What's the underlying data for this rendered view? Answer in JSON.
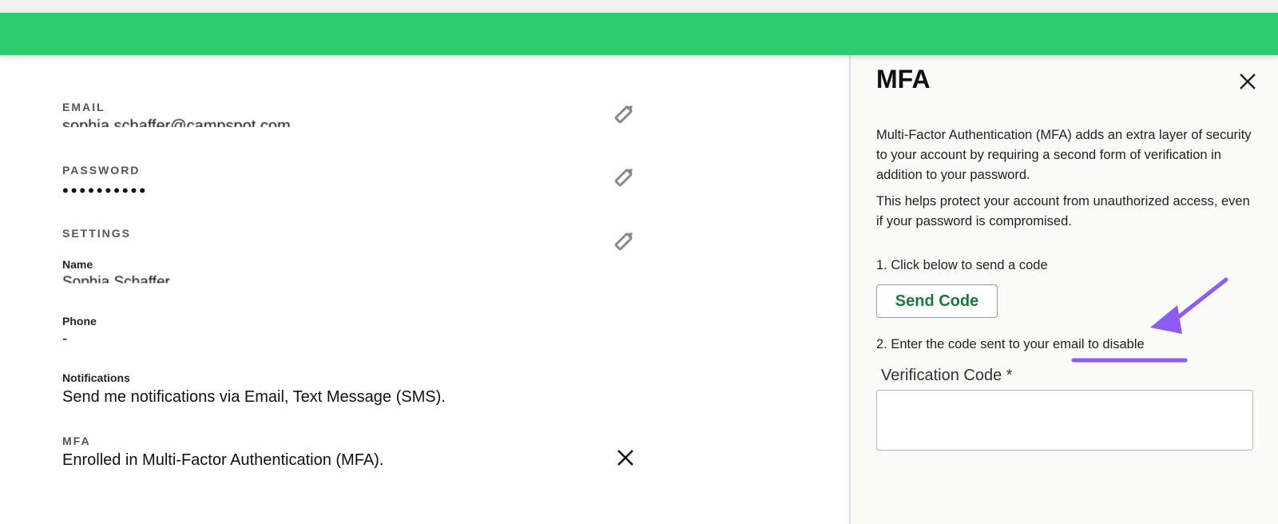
{
  "account": {
    "email_label": "EMAIL",
    "email_value": "sophia.schaffer@campspot.com",
    "password_label": "PASSWORD",
    "password_value": "••••••••••",
    "settings_label": "SETTINGS",
    "name_label": "Name",
    "name_value": "Sophia Schaffer",
    "phone_label": "Phone",
    "phone_value": "-",
    "notifications_label": "Notifications",
    "notifications_value": "Send me notifications via Email, Text Message (SMS).",
    "mfa_label": "MFA",
    "mfa_value": "Enrolled in Multi-Factor Authentication (MFA)."
  },
  "panel": {
    "title": "MFA",
    "desc1": "Multi-Factor Authentication (MFA) adds an extra layer of security to your account by requiring a second form of verification in addition to your password.",
    "desc2": "This helps protect your account from unauthorized access, even if your password is compromised.",
    "step1": "1. Click below to send a code",
    "send_button": "Send Code",
    "step2": "2. Enter the code sent to your email to disable",
    "verification_label": "Verification Code *",
    "verification_value": ""
  },
  "colors": {
    "header_green": "#2ecc71",
    "send_button_text": "#1a7a3c",
    "annotation_purple": "#8b5cf6"
  },
  "icons": {
    "edit": "pencil-icon",
    "close": "close-icon",
    "annotation": "arrow-annotation"
  }
}
